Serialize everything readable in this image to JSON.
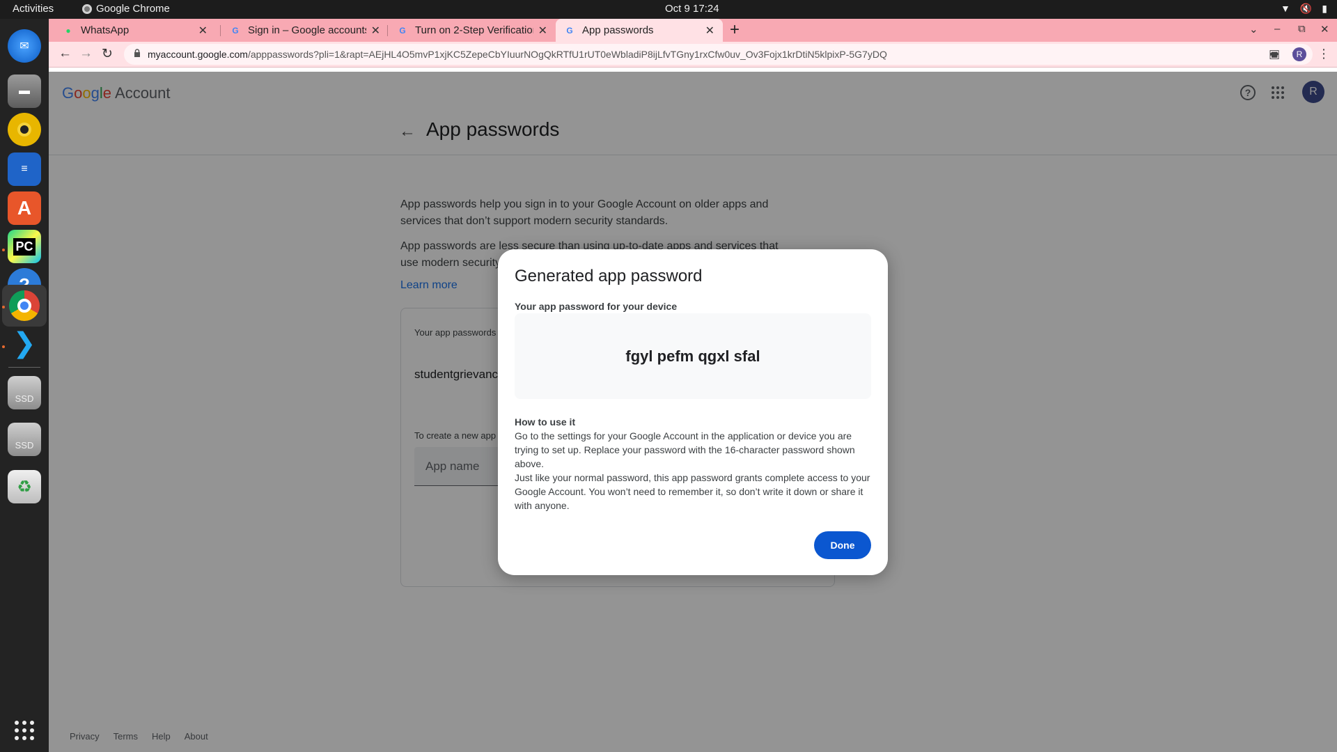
{
  "topbar": {
    "activities": "Activities",
    "app_name": "Google Chrome",
    "clock": "Oct 9  17:24"
  },
  "dock": {
    "apps": [
      "thunderbird-icon",
      "files-icon",
      "rhythmbox-icon",
      "writer-icon",
      "app-center-icon",
      "pycharm-icon",
      "help-icon",
      "chrome-icon",
      "vscode-icon",
      "ssd-drive-icon",
      "ssd-drive-icon",
      "trash-icon",
      "show-apps-icon"
    ],
    "pycharm_label": "PC",
    "ssd_label": "SSD"
  },
  "tabs": [
    {
      "title": "WhatsApp",
      "icon": "whatsapp-icon"
    },
    {
      "title": "Sign in – Google accounts",
      "icon": "google-icon"
    },
    {
      "title": "Turn on 2-Step Verification",
      "icon": "google-icon"
    },
    {
      "title": "App passwords",
      "icon": "google-icon",
      "active": true
    }
  ],
  "omnibox": {
    "host": "myaccount.google.com",
    "path": "/apppasswords?pli=1&rapt=AEjHL4O5mvP1xjKC5ZepeCbYIuurNOgQkRTfU1rUT0eWbladiP8ijLfvTGny1rxCfw0uv_Ov3Fojx1krDtiN5klpixP-5G7yDQ"
  },
  "profile_initial": "R",
  "header": {
    "logo_google": "Google",
    "logo_account": "Account",
    "avatar_initial": "R"
  },
  "page": {
    "title": "App passwords",
    "para1": "App passwords help you sign in to your Google Account on older apps and services that don’t support modern security standards.",
    "para2": "App passwords are less secure than using up-to-date apps and services that use modern security standards. Before you create an app password, you should check to",
    "learn_more": "Learn more",
    "card_label": "Your app passwords",
    "entry": "studentgrievanc",
    "create_label": "To create a new app",
    "app_name_placeholder": "App name"
  },
  "footer": [
    "Privacy",
    "Terms",
    "Help",
    "About"
  ],
  "dialog": {
    "title": "Generated app password",
    "subtitle": "Your app password for your device",
    "password": "fgyl pefm qgxl sfal",
    "how_title": "How to use it",
    "instr1": "Go to the settings for your Google Account in the application or device you are trying to set up. Replace your password with the 16-character password shown above.",
    "instr2": "Just like your normal password, this app password grants complete access to your Google Account. You won’t need to remember it, so don’t write it down or share it with anyone.",
    "done": "Done"
  },
  "colors": {
    "tabstrip": "#f8a9b3",
    "toolbar": "#ffe1e5",
    "primary_button": "#0b57d0",
    "link": "#1a73e8"
  }
}
